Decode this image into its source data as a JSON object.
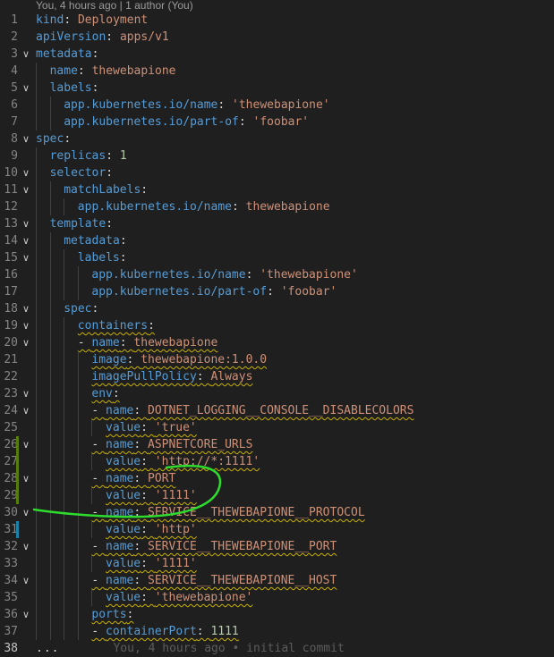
{
  "codelens": "You, 4 hours ago | 1 author (You)",
  "colors": {
    "background": "#1f1f1f",
    "key": "#569cd6",
    "string": "#ce9178",
    "number": "#b5cea8",
    "warning_squiggle": "#c8b000",
    "added_bar": "#587c0c",
    "modified_bar": "#1b81a8",
    "annotation": "#2ddc2d"
  },
  "lines": [
    {
      "n": "1",
      "indent": 0,
      "tokens": [
        [
          "k",
          "kind"
        ],
        [
          "p",
          ": "
        ],
        [
          "s",
          "Deployment"
        ]
      ]
    },
    {
      "n": "2",
      "indent": 0,
      "tokens": [
        [
          "k",
          "apiVersion"
        ],
        [
          "p",
          ": "
        ],
        [
          "s",
          "apps/v1"
        ]
      ]
    },
    {
      "n": "3",
      "indent": 0,
      "fold": "chevron-down",
      "tokens": [
        [
          "k",
          "metadata"
        ],
        [
          "p",
          ":"
        ]
      ]
    },
    {
      "n": "4",
      "indent": 1,
      "tokens": [
        [
          "k",
          "name"
        ],
        [
          "p",
          ": "
        ],
        [
          "s",
          "thewebapione"
        ]
      ]
    },
    {
      "n": "5",
      "indent": 1,
      "fold": "chevron-down",
      "tokens": [
        [
          "k",
          "labels"
        ],
        [
          "p",
          ":"
        ]
      ]
    },
    {
      "n": "6",
      "indent": 2,
      "tokens": [
        [
          "k",
          "app.kubernetes.io/name"
        ],
        [
          "p",
          ": "
        ],
        [
          "s",
          "'thewebapione'"
        ]
      ]
    },
    {
      "n": "7",
      "indent": 2,
      "tokens": [
        [
          "k",
          "app.kubernetes.io/part-of"
        ],
        [
          "p",
          ": "
        ],
        [
          "s",
          "'foobar'"
        ]
      ]
    },
    {
      "n": "8",
      "indent": 0,
      "fold": "chevron-down",
      "tokens": [
        [
          "k",
          "spec"
        ],
        [
          "p",
          ":"
        ]
      ]
    },
    {
      "n": "9",
      "indent": 1,
      "tokens": [
        [
          "k",
          "replicas"
        ],
        [
          "p",
          ": "
        ],
        [
          "n",
          "1"
        ]
      ]
    },
    {
      "n": "10",
      "indent": 1,
      "fold": "chevron-down",
      "tokens": [
        [
          "k",
          "selector"
        ],
        [
          "p",
          ":"
        ]
      ]
    },
    {
      "n": "11",
      "indent": 2,
      "fold": "chevron-down",
      "tokens": [
        [
          "k",
          "matchLabels"
        ],
        [
          "p",
          ":"
        ]
      ]
    },
    {
      "n": "12",
      "indent": 3,
      "tokens": [
        [
          "k",
          "app.kubernetes.io/name"
        ],
        [
          "p",
          ": "
        ],
        [
          "s",
          "thewebapione"
        ]
      ]
    },
    {
      "n": "13",
      "indent": 1,
      "fold": "chevron-down",
      "tokens": [
        [
          "k",
          "template"
        ],
        [
          "p",
          ":"
        ]
      ]
    },
    {
      "n": "14",
      "indent": 2,
      "fold": "chevron-down",
      "tokens": [
        [
          "k",
          "metadata"
        ],
        [
          "p",
          ":"
        ]
      ]
    },
    {
      "n": "15",
      "indent": 3,
      "fold": "chevron-down",
      "tokens": [
        [
          "k",
          "labels"
        ],
        [
          "p",
          ":"
        ]
      ]
    },
    {
      "n": "16",
      "indent": 4,
      "tokens": [
        [
          "k",
          "app.kubernetes.io/name"
        ],
        [
          "p",
          ": "
        ],
        [
          "s",
          "'thewebapione'"
        ]
      ]
    },
    {
      "n": "17",
      "indent": 4,
      "tokens": [
        [
          "k",
          "app.kubernetes.io/part-of"
        ],
        [
          "p",
          ": "
        ],
        [
          "s",
          "'foobar'"
        ]
      ]
    },
    {
      "n": "18",
      "indent": 2,
      "fold": "chevron-down",
      "tokens": [
        [
          "k",
          "spec"
        ],
        [
          "p",
          ":"
        ]
      ]
    },
    {
      "n": "19",
      "indent": 3,
      "fold": "chevron-down",
      "squig": true,
      "tokens": [
        [
          "k",
          "containers"
        ],
        [
          "p",
          ":"
        ]
      ]
    },
    {
      "n": "20",
      "indent": 3,
      "fold": "chevron-down",
      "squig": true,
      "tokens": [
        [
          "p",
          "- "
        ],
        [
          "k",
          "name"
        ],
        [
          "p",
          ": "
        ],
        [
          "s",
          "thewebapione"
        ]
      ]
    },
    {
      "n": "21",
      "indent": 4,
      "squig": true,
      "tokens": [
        [
          "k",
          "image"
        ],
        [
          "p",
          ": "
        ],
        [
          "s",
          "thewebapione:1.0.0"
        ]
      ]
    },
    {
      "n": "22",
      "indent": 4,
      "squig": true,
      "tokens": [
        [
          "k",
          "imagePullPolicy"
        ],
        [
          "p",
          ": "
        ],
        [
          "s",
          "Always"
        ]
      ]
    },
    {
      "n": "23",
      "indent": 4,
      "fold": "chevron-down",
      "squig": true,
      "tokens": [
        [
          "k",
          "env"
        ],
        [
          "p",
          ":"
        ]
      ]
    },
    {
      "n": "24",
      "indent": 4,
      "fold": "chevron-down",
      "squig": true,
      "tokens": [
        [
          "p",
          "- "
        ],
        [
          "k",
          "name"
        ],
        [
          "p",
          ": "
        ],
        [
          "s",
          "DOTNET_LOGGING__CONSOLE__DISABLECOLORS"
        ]
      ]
    },
    {
      "n": "25",
      "indent": 5,
      "squig": true,
      "tokens": [
        [
          "k",
          "value"
        ],
        [
          "p",
          ": "
        ],
        [
          "s",
          "'true'"
        ]
      ]
    },
    {
      "n": "26",
      "indent": 4,
      "fold": "chevron-down",
      "squig": true,
      "mod": "added",
      "tokens": [
        [
          "p",
          "- "
        ],
        [
          "k",
          "name"
        ],
        [
          "p",
          ": "
        ],
        [
          "s",
          "ASPNETCORE_URLS"
        ]
      ]
    },
    {
      "n": "27",
      "indent": 5,
      "squig": true,
      "mod": "added",
      "tokens": [
        [
          "k",
          "value"
        ],
        [
          "p",
          ": "
        ],
        [
          "s",
          "'http://*:1111'"
        ]
      ]
    },
    {
      "n": "28",
      "indent": 4,
      "fold": "chevron-down",
      "squig": true,
      "mod": "added",
      "tokens": [
        [
          "p",
          "- "
        ],
        [
          "k",
          "name"
        ],
        [
          "p",
          ": "
        ],
        [
          "s",
          "PORT"
        ]
      ]
    },
    {
      "n": "29",
      "indent": 5,
      "squig": true,
      "mod": "added",
      "tokens": [
        [
          "k",
          "value"
        ],
        [
          "p",
          ": "
        ],
        [
          "s",
          "'1111'"
        ]
      ]
    },
    {
      "n": "30",
      "indent": 4,
      "fold": "chevron-down",
      "squig": true,
      "tokens": [
        [
          "p",
          "- "
        ],
        [
          "k",
          "name"
        ],
        [
          "p",
          ": "
        ],
        [
          "s",
          "SERVICE__THEWEBAPIONE__PROTOCOL"
        ]
      ]
    },
    {
      "n": "31",
      "indent": 5,
      "squig": true,
      "mod": "modified",
      "tokens": [
        [
          "k",
          "value"
        ],
        [
          "p",
          ": "
        ],
        [
          "s",
          "'http'"
        ]
      ]
    },
    {
      "n": "32",
      "indent": 4,
      "fold": "chevron-down",
      "squig": true,
      "tokens": [
        [
          "p",
          "- "
        ],
        [
          "k",
          "name"
        ],
        [
          "p",
          ": "
        ],
        [
          "s",
          "SERVICE__THEWEBAPIONE__PORT"
        ]
      ]
    },
    {
      "n": "33",
      "indent": 5,
      "squig": true,
      "tokens": [
        [
          "k",
          "value"
        ],
        [
          "p",
          ": "
        ],
        [
          "s",
          "'1111'"
        ]
      ]
    },
    {
      "n": "34",
      "indent": 4,
      "fold": "chevron-down",
      "squig": true,
      "tokens": [
        [
          "p",
          "- "
        ],
        [
          "k",
          "name"
        ],
        [
          "p",
          ": "
        ],
        [
          "s",
          "SERVICE__THEWEBAPIONE__HOST"
        ]
      ]
    },
    {
      "n": "35",
      "indent": 5,
      "squig": true,
      "tokens": [
        [
          "k",
          "value"
        ],
        [
          "p",
          ": "
        ],
        [
          "s",
          "'thewebapione'"
        ]
      ]
    },
    {
      "n": "36",
      "indent": 4,
      "fold": "chevron-down",
      "squig": true,
      "tokens": [
        [
          "k",
          "ports"
        ],
        [
          "p",
          ":"
        ]
      ]
    },
    {
      "n": "37",
      "indent": 4,
      "squig": true,
      "tokens": [
        [
          "p",
          "- "
        ],
        [
          "k",
          "containerPort"
        ],
        [
          "p",
          ": "
        ],
        [
          "n",
          "1111"
        ]
      ]
    },
    {
      "n": "38",
      "indent": 0,
      "active": true,
      "ellipsis": "...",
      "blame": "You, 4 hours ago • initial commit",
      "tokens": []
    }
  ]
}
